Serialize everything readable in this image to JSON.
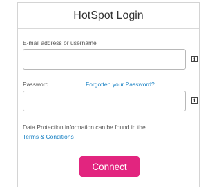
{
  "login": {
    "title": "HotSpot Login",
    "email_label": "E-mail address or username",
    "email_value": "",
    "password_label": "Password",
    "forgot_link": "Forgotten your Password?",
    "password_value": "",
    "info_icon_glyph": "i",
    "privacy_text": "Data Protection information can be found in the",
    "terms_link": "Terms & Conditions",
    "connect_label": "Connect"
  },
  "colors": {
    "accent": "#e2257f",
    "link": "#1a82c4",
    "border": "#b8b8b8"
  },
  "icons": [
    "info-icon",
    "info-icon"
  ]
}
